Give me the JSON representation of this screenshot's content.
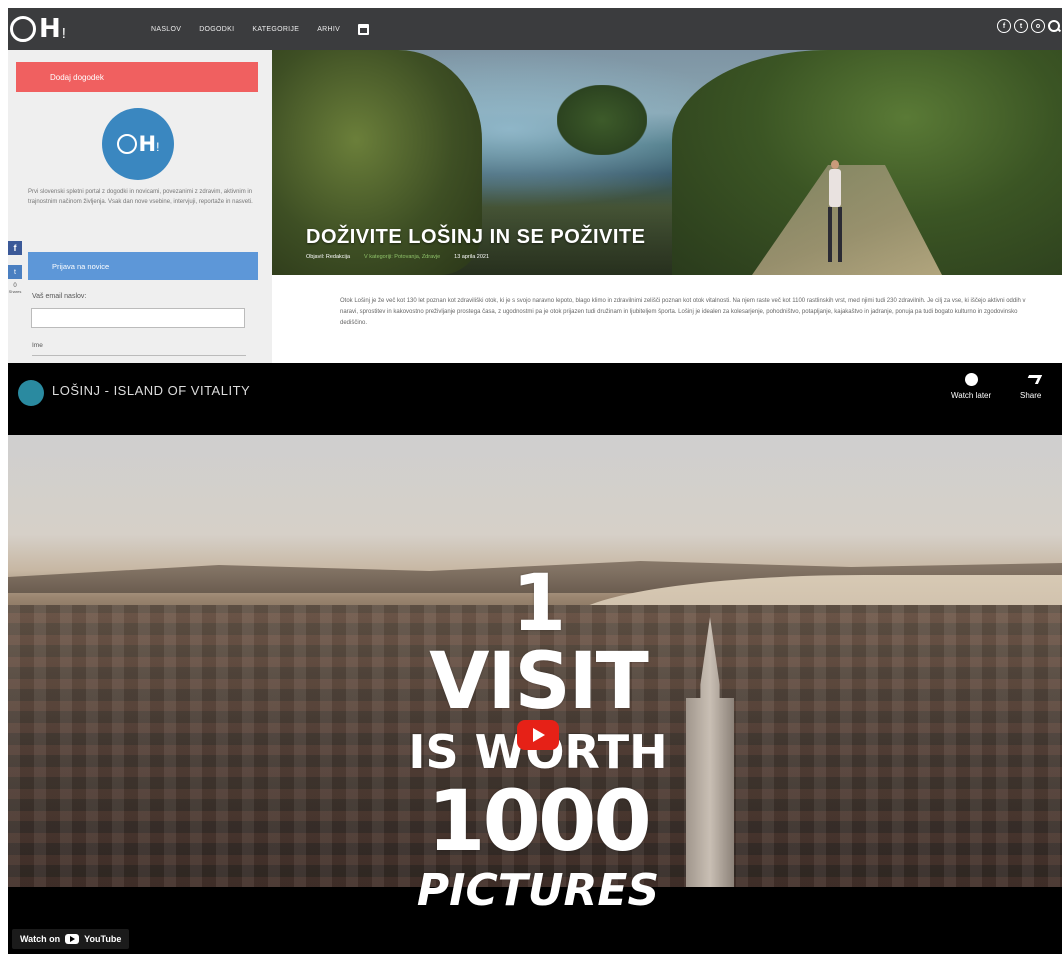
{
  "nav": {
    "items": [
      "NASLOV",
      "DOGODKI",
      "KATEGORIJE",
      "ARHIV"
    ]
  },
  "sidebar": {
    "btn_red": "Dodaj dogodek",
    "description": "Prvi slovenski spletni portal z dogodki in novicami, povezanimi z zdravim, aktivnim in trajnostnim načinom življenja. Vsak dan nove vsebine, intervjuji, reportaže in nasveti.",
    "btn_blue": "Prijava na novice",
    "form_label": "Vaš email naslov:",
    "form_label2": "Ime",
    "share_count": "0",
    "share_label": "Shares"
  },
  "hero": {
    "title": "DOŽIVITE LOŠINJ IN SE POŽIVITE",
    "meta_author": "Objavil: Redakcija",
    "meta_category": "V kategoriji: Potovanja, Zdravje",
    "meta_date": "13 aprila 2021"
  },
  "article": {
    "text": "Otok Lošinj je že več kot 130 let poznan kot zdraviliški otok, ki je s svojo naravno lepoto, blago klimo in zdravilnimi zelišči poznan kot otok vitalnosti. Na njem raste več kot 1100 rastlinskih vrst, med njimi tudi 230 zdravilnih. Je cilj za vse, ki iščejo aktivni oddih v naravi, sprostitev in kakovostno preživljanje prostega časa, z ugodnostmi pa je otok prijazen tudi družinam in ljubiteljem športa. Lošinj je idealen za kolesarjenje, pohodništvo, potapljanje, kajakaštvo in jadranje, ponuja pa tudi bogato kulturno in zgodovinsko dediščino."
  },
  "video": {
    "title": "LOŠINJ - ISLAND OF VITALITY",
    "watch_later": "Watch later",
    "share": "Share",
    "overlay_line1": "1 VISIT",
    "overlay_line2": "IS WORTH",
    "overlay_line3": "1000",
    "overlay_line4": "PICTURES",
    "watch_on": "Watch on",
    "youtube": "YouTube"
  }
}
